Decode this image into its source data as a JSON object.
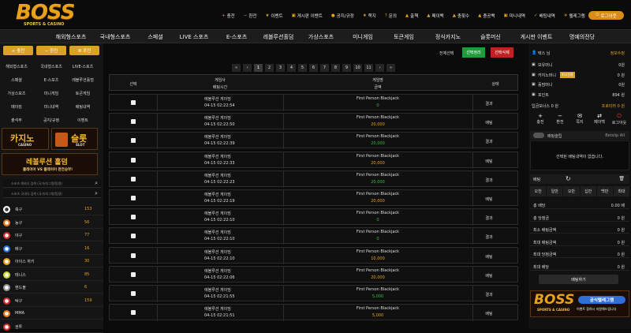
{
  "logo": {
    "main": "BOSS",
    "sub": "SPORTS & CASINO"
  },
  "top_nav": [
    {
      "icon": "+",
      "label": "충전"
    },
    {
      "icon": "−",
      "label": "환전"
    },
    {
      "icon": "★",
      "label": "이벤트"
    },
    {
      "icon": "▣",
      "label": "게시판 이벤트"
    },
    {
      "icon": "●",
      "label": "공지/규정"
    },
    {
      "icon": "★",
      "label": "쪽지"
    },
    {
      "icon": "?",
      "label": "문의"
    },
    {
      "icon": "▲",
      "label": "출첵"
    },
    {
      "icon": "▲",
      "label": "페이백"
    },
    {
      "icon": "▲",
      "label": "충횟수"
    },
    {
      "icon": "▲",
      "label": "충공백"
    },
    {
      "icon": "▣",
      "label": "미니내역"
    },
    {
      "icon": "✓",
      "label": "배팅내역"
    },
    {
      "icon": "✈",
      "label": "텔레그램"
    }
  ],
  "login_label": "로그아웃",
  "main_menu": [
    "해외형스포츠",
    "국내형스포츠",
    "스페셜",
    "LIVE 스포츠",
    "E-스포츠",
    "레볼루션홀덤",
    "가상스포츠",
    "미니게임",
    "토큰게임",
    "정식카지노",
    "슬롯머신",
    "게시판 이벤트",
    "명예의전당"
  ],
  "left": {
    "buttons": [
      "+ 충전",
      "− 환전",
      "⚙ 포인"
    ],
    "links": [
      [
        "해외형스포츠",
        "국내형스포츠",
        "LIVE-스포츠"
      ],
      [
        "스페셜",
        "E-스포츠",
        "레볼루션홀덤"
      ],
      [
        "가상스포츠",
        "미니게임",
        "토큰게임"
      ],
      [
        "메이킹",
        "미니내역",
        "배팅내역"
      ],
      [
        "출석부",
        "공지/규정",
        "이벤트"
      ]
    ],
    "casino_banner": {
      "title": "카지노",
      "sub": "CASINO"
    },
    "slot_banner": {
      "title": "슬롯",
      "sub": "SLOT"
    },
    "holdem_banner": {
      "title": "레볼루션 홀덤",
      "sub": "플레이어 VS 플레이어 완전승부!"
    },
    "search_placeholders": [
      "스포츠 해외식 검색 (국가/리그명/팀명)",
      "스포츠 국내식 검색 (국가/리그명/팀명)"
    ],
    "sports": [
      {
        "name": "축구",
        "count": "153",
        "color": "#ffffff",
        "icon": "soccer-ball-icon"
      },
      {
        "name": "농구",
        "count": "56",
        "color": "#e8761a",
        "icon": "basketball-icon"
      },
      {
        "name": "야구",
        "count": "77",
        "color": "#d83030",
        "icon": "baseball-icon"
      },
      {
        "name": "배구",
        "count": "16",
        "color": "#2d6fd8",
        "icon": "volleyball-icon"
      },
      {
        "name": "아이스 하키",
        "count": "30",
        "color": "#e8a21a",
        "icon": "hockey-icon"
      },
      {
        "name": "테니스",
        "count": "85",
        "color": "#c8d82a",
        "icon": "tennis-icon"
      },
      {
        "name": "핸드볼",
        "count": "6",
        "color": "#999999",
        "icon": "handball-icon"
      },
      {
        "name": "탁구",
        "count": "159",
        "color": "#d83030",
        "icon": "table-tennis-icon"
      },
      {
        "name": "MMA",
        "count": "",
        "color": "#e8761a",
        "icon": "mma-icon"
      },
      {
        "name": "권투",
        "count": "",
        "color": "#d83030",
        "icon": "boxing-icon"
      }
    ]
  },
  "pager": [
    "«",
    "‹",
    "1",
    "2",
    "3",
    "4",
    "5",
    "6",
    "7",
    "8",
    "9",
    "10",
    "11",
    "›",
    "»"
  ],
  "controls": {
    "select_all": "전체선택",
    "select_btn": "선택정리",
    "delete_btn": "선택삭제"
  },
  "table": {
    "header": {
      "select": "선택",
      "type_time_1": "게임사",
      "type_time_2": "배팅시간",
      "game_amount_1": "게임명",
      "game_amount_2": "금액",
      "status": "상태"
    },
    "rows": [
      {
        "provider": "에볼루션 게이밍",
        "time": "04-15 02:22:54",
        "game": "First Person Blackjack",
        "amount": "0",
        "amount_color": "#2fbf3a",
        "status": "결과"
      },
      {
        "provider": "에볼루션 게이밍",
        "time": "04-15 02:22:50",
        "game": "First Person Blackjack",
        "amount": "20,000",
        "amount_color": "#e8a21a",
        "status": "배팅"
      },
      {
        "provider": "에볼루션 게이밍",
        "time": "04-15 02:22:39",
        "game": "First Person Blackjack",
        "amount": "20,000",
        "amount_color": "#2fbf3a",
        "status": "결과"
      },
      {
        "provider": "에볼루션 게이밍",
        "time": "04-15 02:22:33",
        "game": "First Person Blackjack",
        "amount": "20,000",
        "amount_color": "#e8a21a",
        "status": "배팅"
      },
      {
        "provider": "에볼루션 게이밍",
        "time": "04-15 02:22:23",
        "game": "First Person Blackjack",
        "amount": "20,000",
        "amount_color": "#2fbf3a",
        "status": "결과"
      },
      {
        "provider": "에볼루션 게이밍",
        "time": "04-15 02:22:19",
        "game": "First Person Blackjack",
        "amount": "20,000",
        "amount_color": "#e8a21a",
        "status": "배팅"
      },
      {
        "provider": "에볼루션 게이밍",
        "time": "04-15 02:22:10",
        "game": "First Person Blackjack",
        "amount": "0",
        "amount_color": "#2fbf3a",
        "status": "결과"
      },
      {
        "provider": "에볼루션 게이밍",
        "time": "04-15 02:22:10",
        "game": "First Person Blackjack",
        "amount": "0",
        "amount_color": "#2fbf3a",
        "status": "결과"
      },
      {
        "provider": "에볼루션 게이밍",
        "time": "04-15 02:22:10",
        "game": "First Person Blackjack",
        "amount": "10,000",
        "amount_color": "#e8a21a",
        "status": "배팅"
      },
      {
        "provider": "에볼루션 게이밍",
        "time": "04-15 02:22:06",
        "game": "First Person Blackjack",
        "amount": "20,000",
        "amount_color": "#e8a21a",
        "status": "배팅"
      },
      {
        "provider": "에볼루션 게이밍",
        "time": "04-15 02:21:55",
        "game": "First Person Blackjack",
        "amount": "5,000",
        "amount_color": "#2fbf3a",
        "status": "결과"
      },
      {
        "provider": "에볼루션 게이밍",
        "time": "04-15 02:21:51",
        "game": "First Person Blackjack",
        "amount": "5,000",
        "amount_color": "#e8a21a",
        "status": "배팅"
      }
    ]
  },
  "right": {
    "user": {
      "name": "텍스 님",
      "info": "정보수정"
    },
    "balances": [
      {
        "label": "보유머니",
        "value": "0원"
      },
      {
        "label": "카지노머니",
        "badge": "머니전환",
        "value": "0 원"
      },
      {
        "label": "홀덤머니",
        "value": "0원"
      },
      {
        "label": "포인트",
        "value": "894 원"
      }
    ],
    "rolling": {
      "label": "입금보너스 0 원",
      "value": "프로티머 0 원"
    },
    "quick": [
      "충전",
      "환전",
      "쪽지",
      "페이백",
      "로그아웃"
    ],
    "cart_title": "배팅슬립",
    "cart_toggle": "Betslip All",
    "cart_empty": "선택된 배팅내역이 없습니다.",
    "bet_title": "배팅",
    "amount_btns": [
      "오천",
      "일만",
      "오만",
      "십만",
      "백만",
      "최대"
    ],
    "summary": [
      {
        "label": "총 배당",
        "value": "0.00 배"
      },
      {
        "label": "총 당첨금",
        "value": "0 원"
      },
      {
        "label": "최소 배팅금액",
        "value": "0 원"
      },
      {
        "label": "최대 배팅금액",
        "value": "0 원"
      },
      {
        "label": "최대 당첨금액",
        "value": "0 원"
      },
      {
        "label": "최대 배당",
        "value": "0 원"
      }
    ],
    "bet_button": "배팅하기",
    "banners": [
      {
        "logo": "BOSS",
        "logo_sub": "SPORTS & CASINO",
        "tag": "공식텔레그램",
        "text": "이벤트 참여시 지원해드립니다"
      }
    ]
  }
}
